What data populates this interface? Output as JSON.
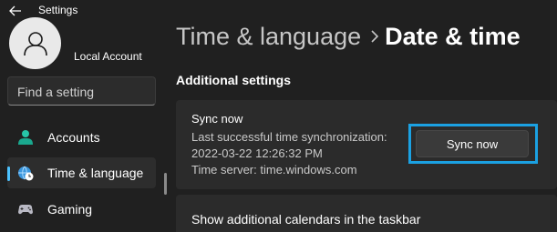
{
  "app": {
    "title": "Settings",
    "back_icon": "back-arrow-icon"
  },
  "account": {
    "name": "Local Account",
    "avatar_icon": "person-icon"
  },
  "search": {
    "placeholder": "Find a setting"
  },
  "sidebar": {
    "items": [
      {
        "label": "Accounts",
        "icon": "accounts-icon",
        "selected": false
      },
      {
        "label": "Time & language",
        "icon": "globe-clock-icon",
        "selected": true
      },
      {
        "label": "Gaming",
        "icon": "controller-icon",
        "selected": false
      }
    ]
  },
  "header": {
    "parent": "Time & language",
    "separator_icon": "chevron-right-icon",
    "current": "Date & time"
  },
  "main": {
    "section_title": "Additional settings",
    "sync": {
      "title": "Sync now",
      "last_sync_label": "Last successful time synchronization:",
      "last_sync_value": "2022-03-22 12:26:32 PM",
      "time_server": "Time server: time.windows.com",
      "button_label": "Sync now"
    },
    "calendars": {
      "label": "Show additional calendars in the taskbar"
    }
  },
  "colors": {
    "background": "#202020",
    "card": "#2b2b2b",
    "accent": "#4cc2ff",
    "highlight": "#1ba1e2"
  }
}
